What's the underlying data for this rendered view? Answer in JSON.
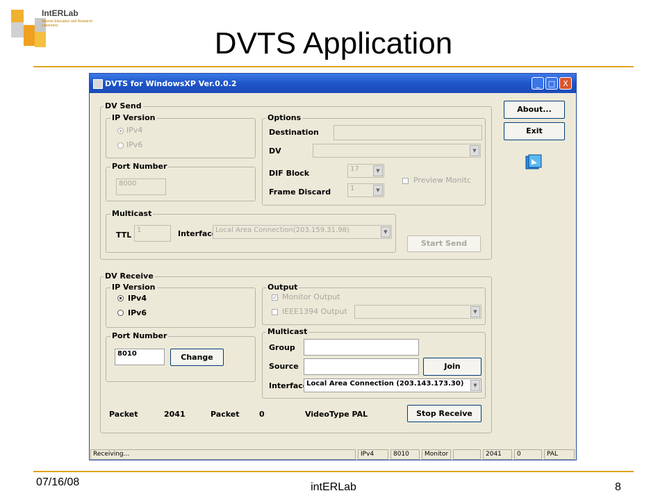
{
  "slide": {
    "title": "DVTS Application",
    "footer_date": "07/16/08",
    "footer_center": "intERLab",
    "page_number": "8",
    "logo_text": "IntERLab",
    "logo_subtext": "Internet Education and Research Laboratory"
  },
  "window": {
    "title": "DVTS for WindowsXP Ver.0.0.2",
    "controls": [
      "_",
      "□",
      "X"
    ]
  },
  "dv_send": {
    "group_label": "DV Send",
    "ip_version_label": "IP Version",
    "ipv4": "IPv4",
    "ipv6": "IPv6",
    "port_number_label": "Port Number",
    "port_value": "8000",
    "options_label": "Options",
    "destination_label": "Destination",
    "dv_label": "DV",
    "dif_block_label": "DIF Block",
    "dif_block_value": "17",
    "frame_discard_label": "Frame Discard",
    "frame_discard_value": "1",
    "preview_monitor": "Preview Monitc",
    "multicast_label": "Multicast",
    "ttl_label": "TTL",
    "ttl_value": "1",
    "interface_label": "Interface",
    "interface_value": "Local Area Connection(203.159.31.98)",
    "start_send": "Start Send"
  },
  "side_buttons": {
    "about": "About...",
    "exit": "Exit"
  },
  "dv_receive": {
    "group_label": "DV Receive",
    "ip_version_label": "IP Version",
    "ipv4": "IPv4",
    "ipv6": "IPv6",
    "port_number_label": "Port Number",
    "port_value": "8010",
    "change": "Change",
    "output_label": "Output",
    "monitor_output": "Monitor Output",
    "ieee_output": "IEEE1394 Output",
    "multicast_label": "Multicast",
    "group_field_label": "Group",
    "source_label": "Source",
    "join": "Join",
    "interface_label": "Interface",
    "interface_value": "Local Area Connection  (203.143.173.30)",
    "packet_label_1": "Packet",
    "packet_value_1": "2041",
    "packet_label_2": "Packet",
    "packet_value_2": "0",
    "videotype": "VideoType PAL",
    "stop_receive": "Stop Receive"
  },
  "status_bar": {
    "message": "Receiving...",
    "ip": "IPv4",
    "port": "8010",
    "output": "Monitor",
    "blank": "",
    "packets": "2041",
    "zero": "0",
    "type": "PAL"
  }
}
